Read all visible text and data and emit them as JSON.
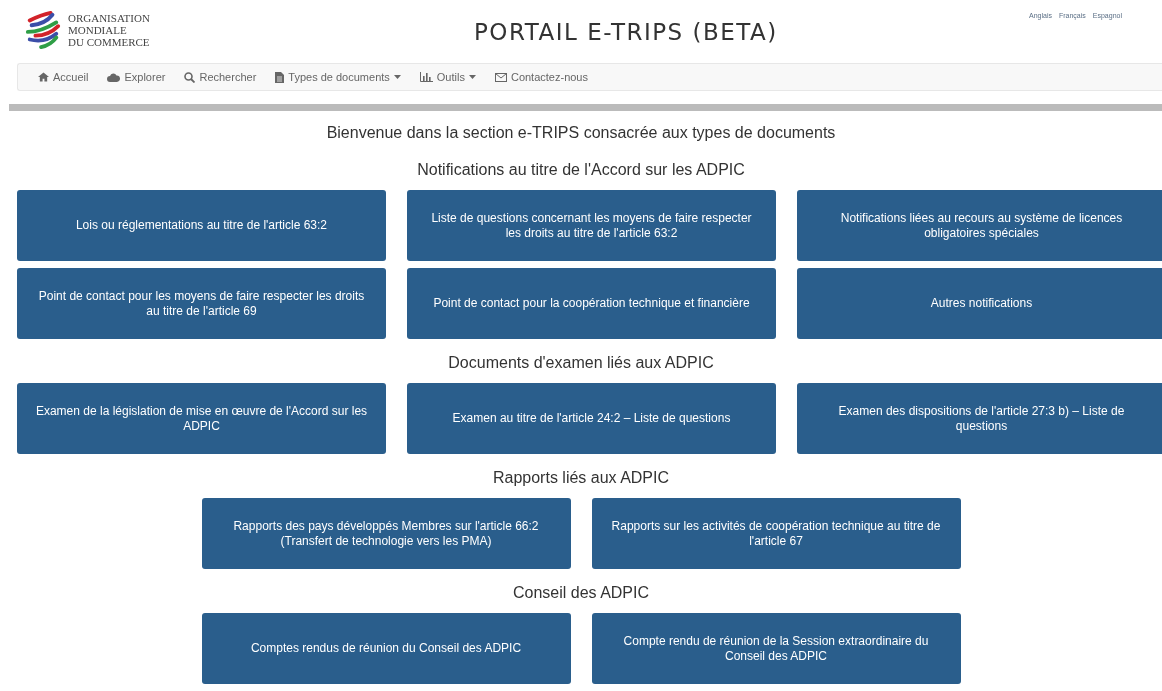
{
  "logo": {
    "lines": [
      "ORGANISATION",
      "MONDIALE",
      "DU COMMERCE"
    ]
  },
  "title": "PORTAIL E-TRIPS (BETA)",
  "languages": [
    "Anglais",
    "Français",
    "Espagnol"
  ],
  "nav": [
    {
      "label": "Accueil",
      "dropdown": false
    },
    {
      "label": "Explorer",
      "dropdown": false
    },
    {
      "label": "Rechercher",
      "dropdown": false
    },
    {
      "label": "Types de documents",
      "dropdown": true
    },
    {
      "label": "Outils",
      "dropdown": true
    },
    {
      "label": "Contactez-nous",
      "dropdown": false
    }
  ],
  "welcome": "Bienvenue dans la section e-TRIPS consacrée aux types de documents",
  "sections": [
    {
      "heading": "Notifications au titre de l'Accord sur les ADPIC",
      "buttons": [
        "Lois ou réglementations au titre de l'article 63:2",
        "Liste de questions concernant les moyens de faire respecter les droits au titre de l'article 63:2",
        "Notifications liées au recours au système de licences obligatoires spéciales",
        "Point de contact pour les moyens de faire respecter les droits au titre de l'article 69",
        "Point de contact pour la coopération technique et financière",
        "Autres notifications"
      ]
    },
    {
      "heading": "Documents d'examen liés aux ADPIC",
      "buttons": [
        "Examen de la législation de mise en œuvre de l'Accord sur les ADPIC",
        "Examen au titre de l'article 24:2 – Liste de questions",
        "Examen des dispositions de l'article 27:3 b) – Liste de questions"
      ]
    },
    {
      "heading": "Rapports liés aux ADPIC",
      "buttons": [
        "Rapports des pays développés Membres sur l'article 66:2 (Transfert de technologie vers les PMA)",
        "Rapports sur les activités de coopération technique au titre de l'article 67"
      ]
    },
    {
      "heading": "Conseil des ADPIC",
      "buttons": [
        "Comptes rendus de réunion du Conseil des ADPIC",
        "Compte rendu de réunion de la Session extraordinaire du Conseil des ADPIC"
      ]
    }
  ]
}
